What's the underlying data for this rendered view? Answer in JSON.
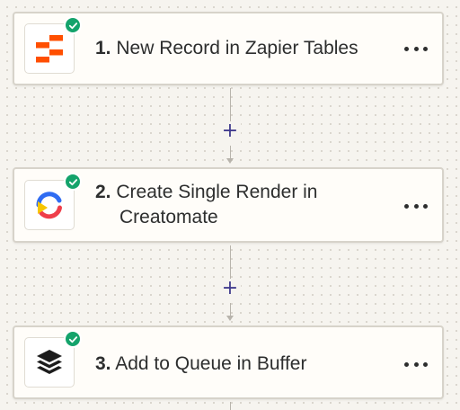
{
  "steps": [
    {
      "number": "1.",
      "title": "New Record in Zapier Tables",
      "app_icon": "zapier-tables-icon",
      "status_icon": "check-icon",
      "menu_icon": "more-horizontal-icon"
    },
    {
      "number": "2.",
      "title": "Create Single Render in Creatomate",
      "app_icon": "creatomate-icon",
      "status_icon": "check-icon",
      "menu_icon": "more-horizontal-icon"
    },
    {
      "number": "3.",
      "title": "Add to Queue in Buffer",
      "app_icon": "buffer-icon",
      "status_icon": "check-icon",
      "menu_icon": "more-horizontal-icon"
    }
  ],
  "connectors": [
    {
      "label": "+",
      "icon": "add-step-icon"
    },
    {
      "label": "+",
      "icon": "add-step-icon"
    }
  ],
  "colors": {
    "canvas_background": "#f6f4ef",
    "card_border": "#d7d3ca",
    "success_green": "#14a36b",
    "plus_color": "#413c8e",
    "zapier_orange": "#ff4f00"
  }
}
